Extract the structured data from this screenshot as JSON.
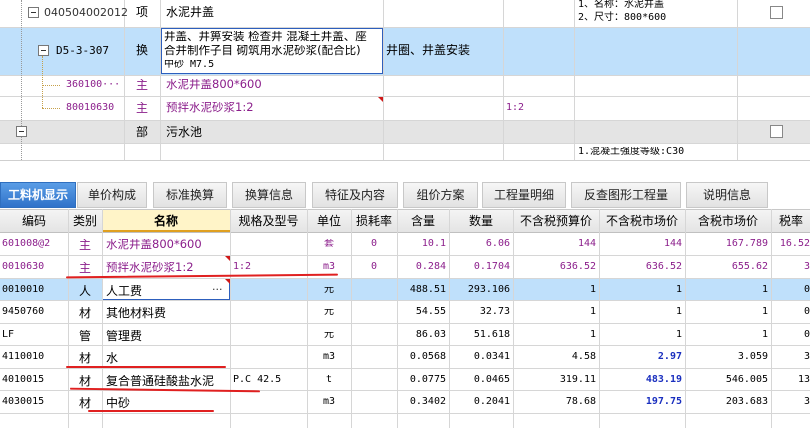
{
  "upper": {
    "rows": [
      {
        "code": "040504002012",
        "type": "项",
        "name": "水泥井盖",
        "feature": "1、名称：水泥井盖\n2、尺寸：800*600"
      },
      {
        "code": "D5-3-307",
        "type": "换",
        "name_lines": [
          "井盖、井箅安装 检查井 混凝土井盖、座",
          "合并制作子目 砌筑用水泥砂浆(配合比)",
          "中砂 M7.5"
        ],
        "work": "井圈、井盖安装"
      },
      {
        "code": "360100···",
        "type": "主",
        "name": "水泥井盖800*600"
      },
      {
        "code": "80010630",
        "type": "主",
        "name": "预拌水泥砂浆1:2",
        "spec": "1:2"
      },
      {
        "code": "",
        "type": "部",
        "name": "污水池"
      },
      {
        "code": "",
        "type": "",
        "name": "",
        "feature": "1.混凝土强度等级:C30"
      }
    ]
  },
  "tabs": [
    "工料机显示",
    "单价构成",
    "标准换算",
    "换算信息",
    "特征及内容",
    "组价方案",
    "工程量明细",
    "反查图形工程量",
    "说明信息"
  ],
  "columns": [
    "编码",
    "类别",
    "名称",
    "规格及型号",
    "单位",
    "损耗率",
    "含量",
    "数量",
    "不含税预算价",
    "不含税市场价",
    "含税市场价",
    "税率"
  ],
  "rows": [
    {
      "code": "601008@2",
      "type": "主",
      "name": "水泥井盖800*600",
      "spec": "",
      "unit": "套",
      "loss": "0",
      "content": "10.1",
      "qty": "6.06",
      "budget": "144",
      "market": "144",
      "tax_market": "167.789",
      "rate": "16.52"
    },
    {
      "code": "0010630",
      "type": "主",
      "name": "预拌水泥砂浆1:2",
      "spec": "1:2",
      "unit": "m3",
      "loss": "0",
      "content": "0.284",
      "qty": "0.1704",
      "budget": "636.52",
      "market": "636.52",
      "tax_market": "655.62",
      "rate": "3"
    },
    {
      "code": "0010010",
      "type": "人",
      "name": "人工费",
      "spec": "",
      "unit": "元",
      "loss": "",
      "content": "488.51",
      "qty": "293.106",
      "budget": "1",
      "market": "1",
      "tax_market": "1",
      "rate": "0"
    },
    {
      "code": "9450760",
      "type": "材",
      "name": "其他材料费",
      "spec": "",
      "unit": "元",
      "loss": "",
      "content": "54.55",
      "qty": "32.73",
      "budget": "1",
      "market": "1",
      "tax_market": "1",
      "rate": "0"
    },
    {
      "code": "LF",
      "type": "管",
      "name": "管理费",
      "spec": "",
      "unit": "元",
      "loss": "",
      "content": "86.03",
      "qty": "51.618",
      "budget": "1",
      "market": "1",
      "tax_market": "1",
      "rate": "0"
    },
    {
      "code": "4110010",
      "type": "材",
      "name": "水",
      "spec": "",
      "unit": "m3",
      "loss": "",
      "content": "0.0568",
      "qty": "0.0341",
      "budget": "4.58",
      "market": "2.97",
      "tax_market": "3.059",
      "rate": "3"
    },
    {
      "code": "4010015",
      "type": "材",
      "name": "复合普通硅酸盐水泥",
      "spec": "P.C 42.5",
      "unit": "t",
      "loss": "",
      "content": "0.0775",
      "qty": "0.0465",
      "budget": "319.11",
      "market": "483.19",
      "tax_market": "546.005",
      "rate": "13"
    },
    {
      "code": "4030015",
      "type": "材",
      "name": "中砂",
      "spec": "",
      "unit": "m3",
      "loss": "",
      "content": "0.3402",
      "qty": "0.2041",
      "budget": "78.68",
      "market": "197.75",
      "tax_market": "203.683",
      "rate": "3"
    }
  ],
  "edit_ellipsis": "···",
  "colors": {
    "selected_row": "#bfe0fb",
    "purple_text": "#8B1E8B",
    "blue_price": "#1a2fbf",
    "annotation_red": "#e02020",
    "tab_active": "#2f72c9"
  }
}
